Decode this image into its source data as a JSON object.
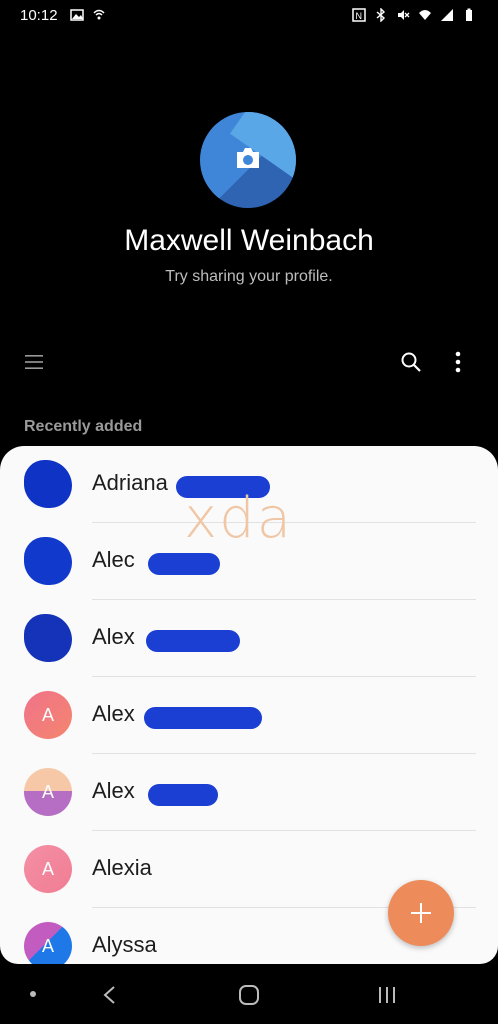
{
  "status_bar": {
    "time": "10:12",
    "left_icons": [
      "image-icon",
      "wifi-call-icon"
    ],
    "right_icons": [
      "nfc-icon",
      "bluetooth-icon",
      "mute-icon",
      "wifi-icon",
      "signal-icon",
      "battery-icon"
    ]
  },
  "profile": {
    "name": "Maxwell Weinbach",
    "subtitle": "Try sharing your profile.",
    "avatar_icon": "camera-icon"
  },
  "toolbar": {
    "icons": [
      "menu-icon",
      "search-icon",
      "more-vert-icon"
    ]
  },
  "section_label": "Recently added",
  "contacts": [
    {
      "name": "Adriana",
      "avatar_letter": ""
    },
    {
      "name": "Alec",
      "avatar_letter": ""
    },
    {
      "name": "Alex",
      "avatar_letter": ""
    },
    {
      "name": "Alex",
      "avatar_letter": "A"
    },
    {
      "name": "Alex",
      "avatar_letter": "A"
    },
    {
      "name": "Alexia",
      "avatar_letter": "A"
    },
    {
      "name": "Alyssa",
      "avatar_letter": "A"
    }
  ],
  "watermark": "xda",
  "fab_icon": "add-icon",
  "colors": {
    "accent": "#ee8b5b",
    "profile_blue": "#3f86d8",
    "redaction": "#1a3fd2"
  }
}
